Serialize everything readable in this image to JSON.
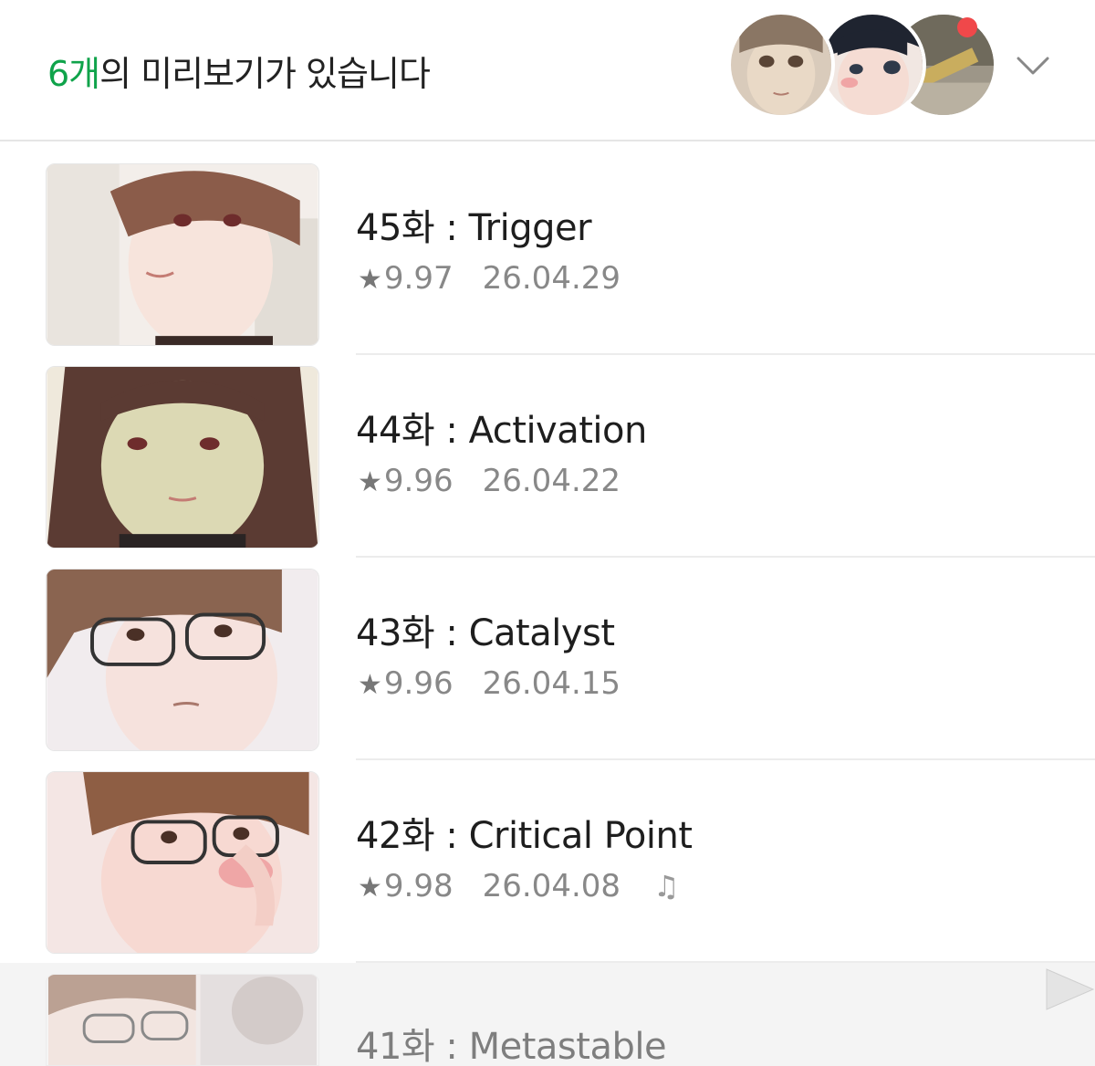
{
  "header": {
    "count": "6개",
    "title_rest": "의 미리보기가 있습니다",
    "avatars": [
      "character-1-avatar",
      "character-2-avatar",
      "character-3-avatar"
    ],
    "notification_color": "#f0484a",
    "accent_color": "#0fa34a"
  },
  "episodes": [
    {
      "title": "45화 : Trigger",
      "star": "★",
      "rating": "9.97",
      "date": "26.04.29",
      "bgm": false
    },
    {
      "title": "44화 : Activation",
      "star": "★",
      "rating": "9.96",
      "date": "26.04.22",
      "bgm": false
    },
    {
      "title": "43화 : Catalyst",
      "star": "★",
      "rating": "9.96",
      "date": "26.04.15",
      "bgm": false
    },
    {
      "title": "42화 : Critical Point",
      "star": "★",
      "rating": "9.98",
      "date": "26.04.08",
      "bgm": true,
      "bgm_icon": "♫"
    },
    {
      "title": "41화 : Metastable"
    }
  ]
}
